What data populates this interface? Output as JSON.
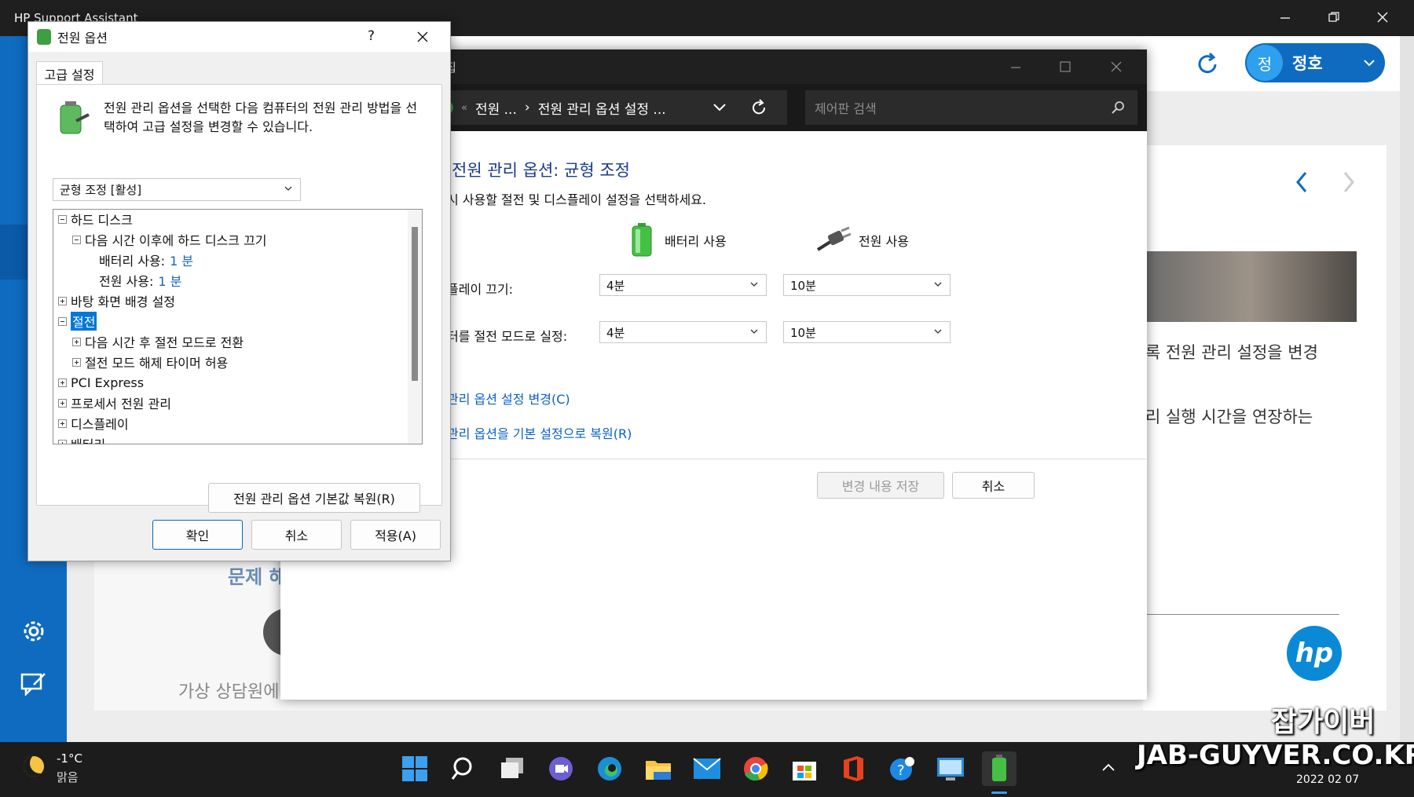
{
  "hp": {
    "title": "HP Support Assistant",
    "user_initial": "정",
    "user_name": "정호",
    "card_heading_partial": "문제 해",
    "card_sub_partial": "가상 상담원에",
    "right_text_1": "록 전원 관리 설정을 변경",
    "right_text_2": "리 실행 시간을 연장하는",
    "logo_text": "hp"
  },
  "cp": {
    "title_partial": "집",
    "breadcrumb_sep": "«",
    "breadcrumb_1": "전원 ...",
    "breadcrumb_arrow": "›",
    "breadcrumb_2": "전원 관리 옵션 설정 ...",
    "search_placeholder": "제어판 검색",
    "heading": "전원 관리 옵션: 균형 조정",
    "subheading": "시 사용할 절전 및 디스플레이 설정을 선택하세요.",
    "col_battery": "배터리 사용",
    "col_plugged": "전원 사용",
    "row1_label": "플레이 끄기:",
    "row1_battery": "4분",
    "row1_plugged": "10분",
    "row2_label": "터를 절전 모드로 실정:",
    "row2_battery": "4분",
    "row2_plugged": "10분",
    "link_advanced": "관리 옵션 설정 변경(C)",
    "link_restore": "관리 옵션을 기본 설정으로 복원(R)",
    "save_button": "변경 내용 저장",
    "cancel_button": "취소"
  },
  "po": {
    "title": "전원 옵션",
    "help": "?",
    "tab": "고급 설정",
    "description": "전원 관리 옵션을 선택한 다음 컴퓨터의 전원 관리 방법을 선택하여 고급 설정을 변경할 수 있습니다.",
    "plan_select": "균형 조정 [활성]",
    "tree": {
      "hdd": "하드 디스크",
      "hdd_off": "다음 시간 이후에 하드 디스크 끄기",
      "battery_label": "배터리 사용:",
      "battery_value": "1 분",
      "plugged_label": "전원 사용:",
      "plugged_value": "1 분",
      "desktop_bg": "바탕 화면 배경 설정",
      "sleep": "절전",
      "sleep_after": "다음 시간 후 절전 모드로 전환",
      "wake_timers": "절전 모드 해제 타이머 허용",
      "pci": "PCI Express",
      "processor": "프로세서 전원 관리",
      "display": "디스플레이",
      "battery_cut": "배터리"
    },
    "restore_button": "전원 관리 옵션 기본값 복원(R)",
    "ok_button": "확인",
    "cancel_button": "취소",
    "apply_button": "적용(A)"
  },
  "taskbar": {
    "temperature": "-1°C",
    "weather": "맑음",
    "date": "2022 02 07",
    "icons": [
      "start-icon",
      "search-icon",
      "task-view-icon",
      "chat-icon",
      "edge-icon",
      "file-explorer-icon",
      "mail-icon",
      "chrome-icon",
      "store-icon",
      "office-icon",
      "support-icon",
      "control-panel-icon",
      "battery-app-icon"
    ]
  },
  "watermark": {
    "name": "잡가이버",
    "url": "JAB-GUYVER.CO.KR"
  },
  "colors": {
    "hp_blue": "#0f6bc0",
    "link_blue": "#0a60c8",
    "selection": "#0078d7"
  }
}
